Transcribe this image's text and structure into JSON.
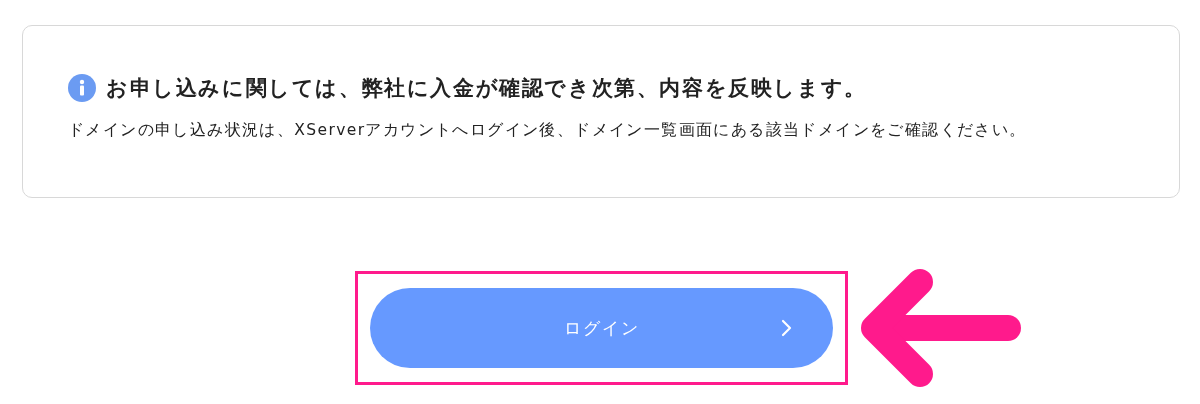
{
  "notice": {
    "title": "お申し込みに関しては、弊社に入金が確認でき次第、内容を反映します。",
    "body": "ドメインの申し込み状況は、XServerアカウントへログイン後、ドメイン一覧画面にある該当ドメインをご確認ください。"
  },
  "login_button": {
    "label": "ログイン",
    "highlighted": true
  }
}
